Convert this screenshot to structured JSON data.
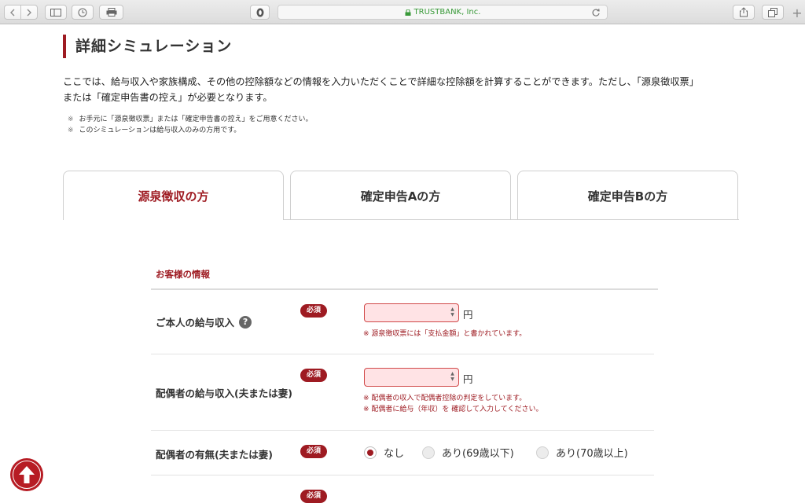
{
  "browser": {
    "url_text": "TRUSTBANK, Inc.",
    "icons": [
      "back-icon",
      "forward-icon",
      "sidebar-icon",
      "history-icon",
      "reading-list-icon",
      "shield-icon",
      "lock-icon",
      "reload-icon",
      "share-icon",
      "tabs-icon",
      "plus-icon"
    ],
    "new_tab_label": "+"
  },
  "header": {
    "title": "詳細シミュレーション"
  },
  "intro": {
    "line1": "ここでは、給与収入や家族構成、その他の控除額などの情報を入力いただくことで詳細な控除額を計算することができます。ただし、「源泉徴収票」",
    "line2": "または「確定申告書の控え」が必要となります。",
    "notes": [
      {
        "mark": "※",
        "text": "お手元に「源泉徴収票」または「確定申告書の控え」をご用意ください。"
      },
      {
        "mark": "※",
        "text": "このシミュレーションは給与収入のみの方用です。"
      }
    ]
  },
  "tabs": [
    {
      "label": "源泉徴収の方",
      "active": true
    },
    {
      "label": "確定申告Aの方",
      "active": false
    },
    {
      "label": "確定申告Bの方",
      "active": false
    }
  ],
  "form": {
    "section_title": "お客様の情報",
    "required_label": "必須",
    "unit_yen": "円",
    "help_icon": "?",
    "rows": [
      {
        "label": "ご本人の給与収入",
        "value": "",
        "hints": [
          "※ 源泉徴収票には「支払金額」と書かれています。"
        ]
      },
      {
        "label": "配偶者の給与収入(夫または妻)",
        "value": "",
        "hints": [
          "※ 配偶者の収入で配偶者控除の判定をしています。",
          "※ 配偶者に給与（年収）を 確認して入力してください。"
        ]
      },
      {
        "label": "配偶者の有無(夫または妻)",
        "options": [
          {
            "label": "なし",
            "selected": true
          },
          {
            "label": "あり(69歳以下)",
            "selected": false
          },
          {
            "label": "あり(70歳以上)",
            "selected": false
          }
        ]
      }
    ]
  },
  "colors": {
    "brand": "#9e1b22",
    "input_bg": "#ffe3e5"
  },
  "page_top_icon": "arrow-up-icon"
}
